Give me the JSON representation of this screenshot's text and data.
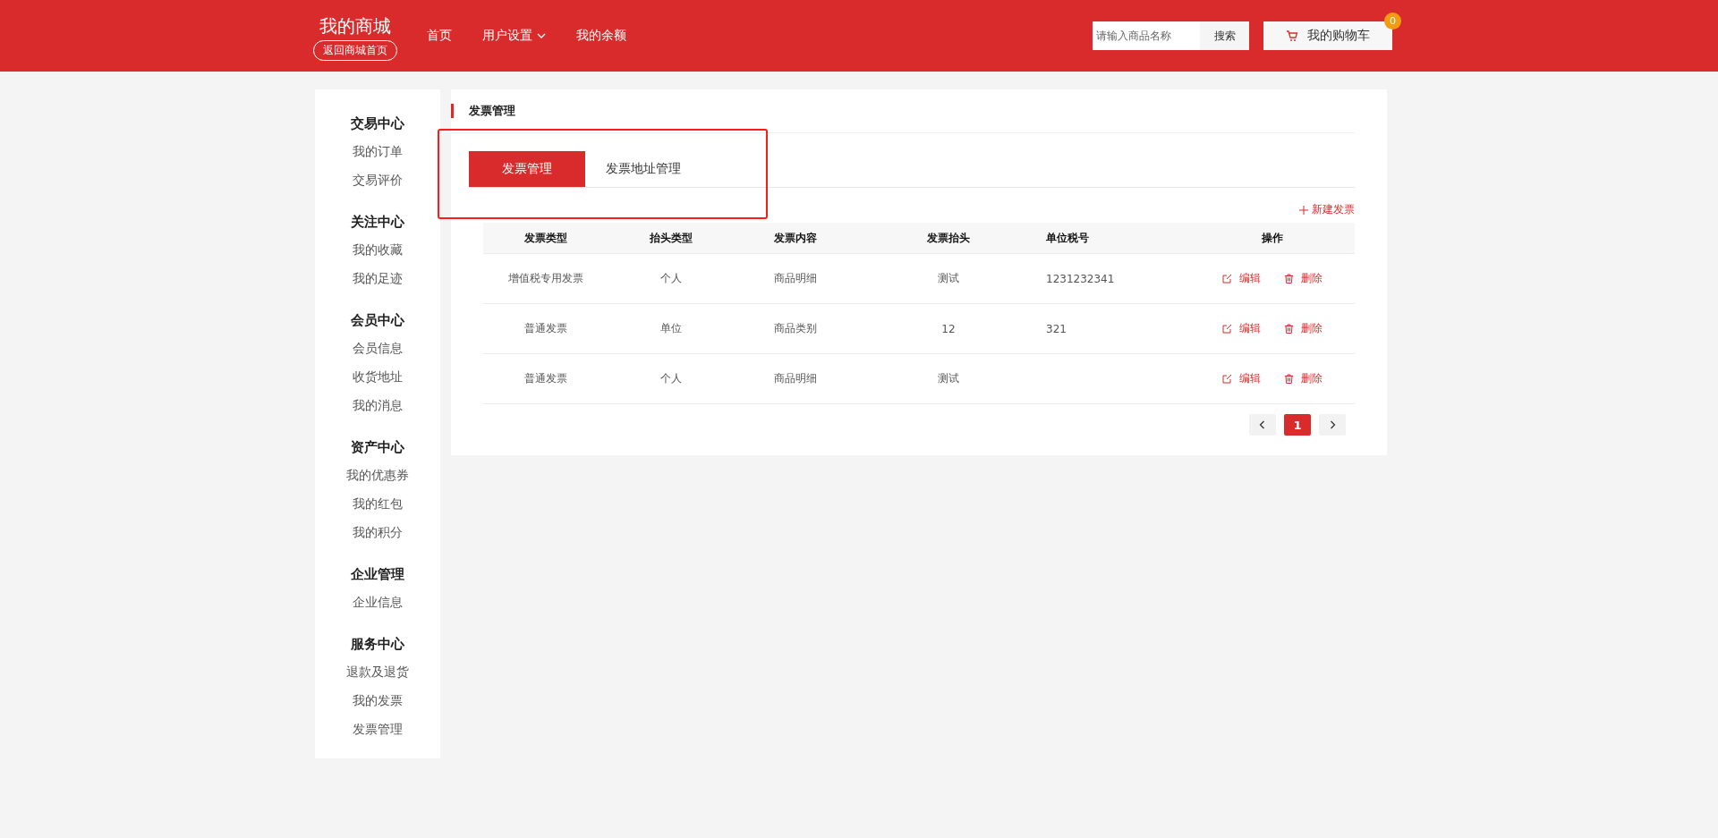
{
  "header": {
    "logo": "我的商城",
    "back_button": "返回商城首页",
    "nav": [
      {
        "label": "首页",
        "kind": "link"
      },
      {
        "label": "用户设置",
        "kind": "dropdown"
      },
      {
        "label": "我的余额",
        "kind": "link"
      }
    ],
    "search": {
      "placeholder": "请输入商品名称",
      "button": "搜索"
    },
    "cart": {
      "label": "我的购物车",
      "count": "0"
    }
  },
  "sidebar": [
    {
      "title": "交易中心",
      "items": [
        "我的订单",
        "交易评价"
      ]
    },
    {
      "title": "关注中心",
      "items": [
        "我的收藏",
        "我的足迹"
      ]
    },
    {
      "title": "会员中心",
      "items": [
        "会员信息",
        "收货地址",
        "我的消息"
      ]
    },
    {
      "title": "资产中心",
      "items": [
        "我的优惠券",
        "我的红包",
        "我的积分"
      ]
    },
    {
      "title": "企业管理",
      "items": [
        "企业信息"
      ]
    },
    {
      "title": "服务中心",
      "items": [
        "退款及退货",
        "我的发票",
        "发票管理"
      ]
    }
  ],
  "panel": {
    "title": "发票管理",
    "tabs": [
      {
        "label": "发票管理",
        "selected": true
      },
      {
        "label": "发票地址管理",
        "selected": false
      }
    ],
    "new_button": "新建发票",
    "table": {
      "columns": [
        "发票类型",
        "抬头类型",
        "发票内容",
        "发票抬头",
        "单位税号",
        "操作"
      ],
      "rows": [
        {
          "cells": [
            "增值税专用发票",
            "个人",
            "商品明细",
            "测试",
            "1231232341"
          ],
          "edit": "编辑",
          "delete": "删除"
        },
        {
          "cells": [
            "普通发票",
            "单位",
            "商品类别",
            "12",
            "321"
          ],
          "edit": "编辑",
          "delete": "删除"
        },
        {
          "cells": [
            "普通发票",
            "个人",
            "商品明细",
            "测试",
            ""
          ],
          "edit": "编辑",
          "delete": "删除"
        }
      ]
    },
    "pagination": {
      "pages": [
        {
          "label": "1",
          "selected": true
        }
      ]
    }
  }
}
